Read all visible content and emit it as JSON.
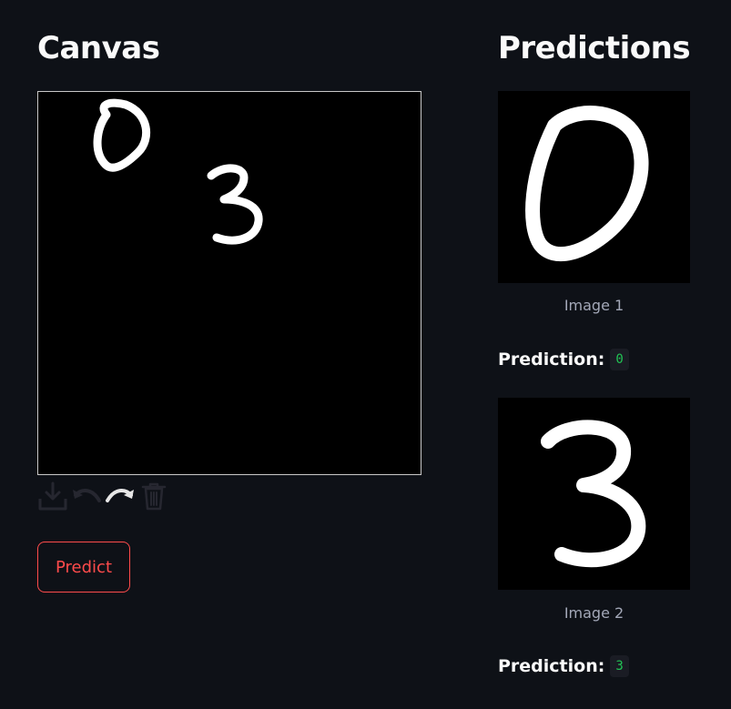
{
  "canvas": {
    "title": "Canvas",
    "toolbar": {
      "download_icon": "download-icon",
      "undo_icon": "undo-icon",
      "redo_icon": "redo-icon",
      "trash_icon": "trash-icon"
    },
    "drawn_digits": [
      "0",
      "3"
    ]
  },
  "actions": {
    "predict_label": "Predict"
  },
  "predictions": {
    "title": "Predictions",
    "items": [
      {
        "caption": "Image 1",
        "label": "Prediction:",
        "value": "0"
      },
      {
        "caption": "Image 2",
        "label": "Prediction:",
        "value": "3"
      }
    ]
  },
  "colors": {
    "background": "#0e1117",
    "primary": "#ff4b4b",
    "code_text": "#21c354",
    "caption": "#a3a8b8"
  }
}
